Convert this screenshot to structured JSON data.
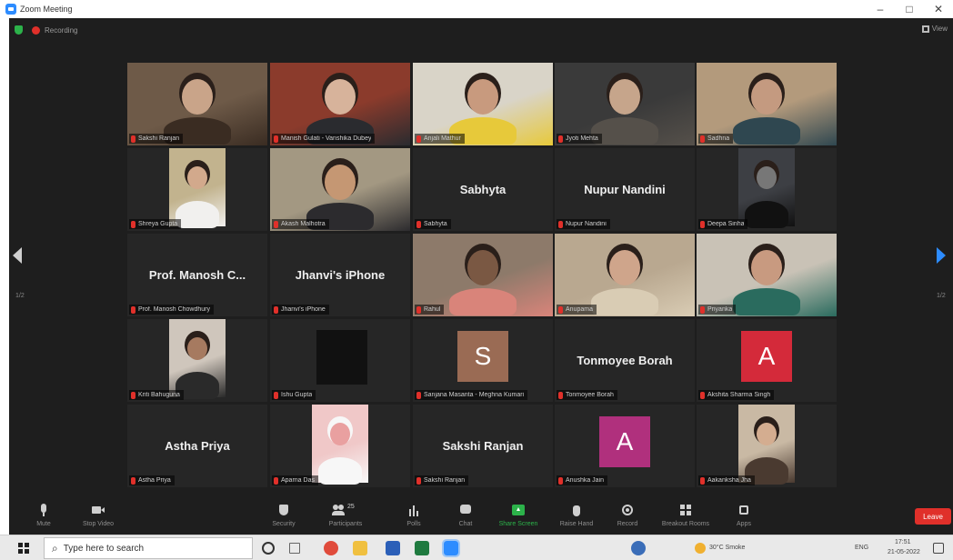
{
  "window": {
    "title": "Zoom Meeting",
    "minimize": "–",
    "maximize": "□",
    "close": "✕"
  },
  "meeting": {
    "recording_label": "Recording",
    "view_label": "View",
    "page_left": "1/2",
    "page_right": "1/2"
  },
  "tiles": [
    {
      "label": "Sakshi Ranjan",
      "kind": "video"
    },
    {
      "label": "Manish Gulati - Vanshika Dubey",
      "kind": "video",
      "active": true
    },
    {
      "label": "Anjali Mathur",
      "kind": "video"
    },
    {
      "label": "Jyoti Mehta",
      "kind": "video"
    },
    {
      "label": "Sadhna",
      "kind": "video"
    },
    {
      "label": "Shreya Gupta",
      "kind": "video-small"
    },
    {
      "label": "Akash Malhotra",
      "kind": "video"
    },
    {
      "label": "Sabhyta",
      "kind": "name",
      "display": "Sabhyta"
    },
    {
      "label": "Nupur Nandini",
      "kind": "name",
      "display": "Nupur Nandini"
    },
    {
      "label": "Deepa Sinha",
      "kind": "video-small"
    },
    {
      "label": "Prof. Manosh Chowdhury",
      "kind": "name",
      "display": "Prof. Manosh C..."
    },
    {
      "label": "Jhanvi's iPhone",
      "kind": "name",
      "display": "Jhanvi's iPhone"
    },
    {
      "label": "Rahul",
      "kind": "video"
    },
    {
      "label": "Anupama",
      "kind": "video"
    },
    {
      "label": "Priyanka",
      "kind": "video"
    },
    {
      "label": "Kriti Bahuguna",
      "kind": "video-small"
    },
    {
      "label": "Ishu Gupta",
      "kind": "dark"
    },
    {
      "label": "Sanjana Masanta - Meghna Kumari",
      "kind": "avatar",
      "letter": "S",
      "color": "#9a6b54"
    },
    {
      "label": "Tonmoyee Borah",
      "kind": "name",
      "display": "Tonmoyee Borah"
    },
    {
      "label": "Akshita Sharma Singh",
      "kind": "avatar",
      "letter": "A",
      "color": "#d42a3a"
    },
    {
      "label": "Astha Priya",
      "kind": "name",
      "display": "Astha Priya"
    },
    {
      "label": "Aparna Das",
      "kind": "image"
    },
    {
      "label": "Sakshi Ranjan",
      "kind": "name",
      "display": "Sakshi Ranjan"
    },
    {
      "label": "Anushka Jain",
      "kind": "avatar",
      "letter": "A",
      "color": "#b0307d"
    },
    {
      "label": "Aakanksha Jha",
      "kind": "video-small"
    }
  ],
  "toolbar": {
    "mute": "Mute",
    "stop_video": "Stop Video",
    "security": "Security",
    "participants": "Participants",
    "participants_count": "25",
    "polls": "Polls",
    "chat": "Chat",
    "share_screen": "Share Screen",
    "raise_hand": "Raise Hand",
    "record": "Record",
    "breakout_rooms": "Breakout Rooms",
    "apps": "Apps",
    "leave": "Leave"
  },
  "taskbar": {
    "search_placeholder": "Type here to search",
    "weather": "30°C Smoke",
    "language": "ENG",
    "time": "17:51",
    "date": "21-05-2022"
  }
}
